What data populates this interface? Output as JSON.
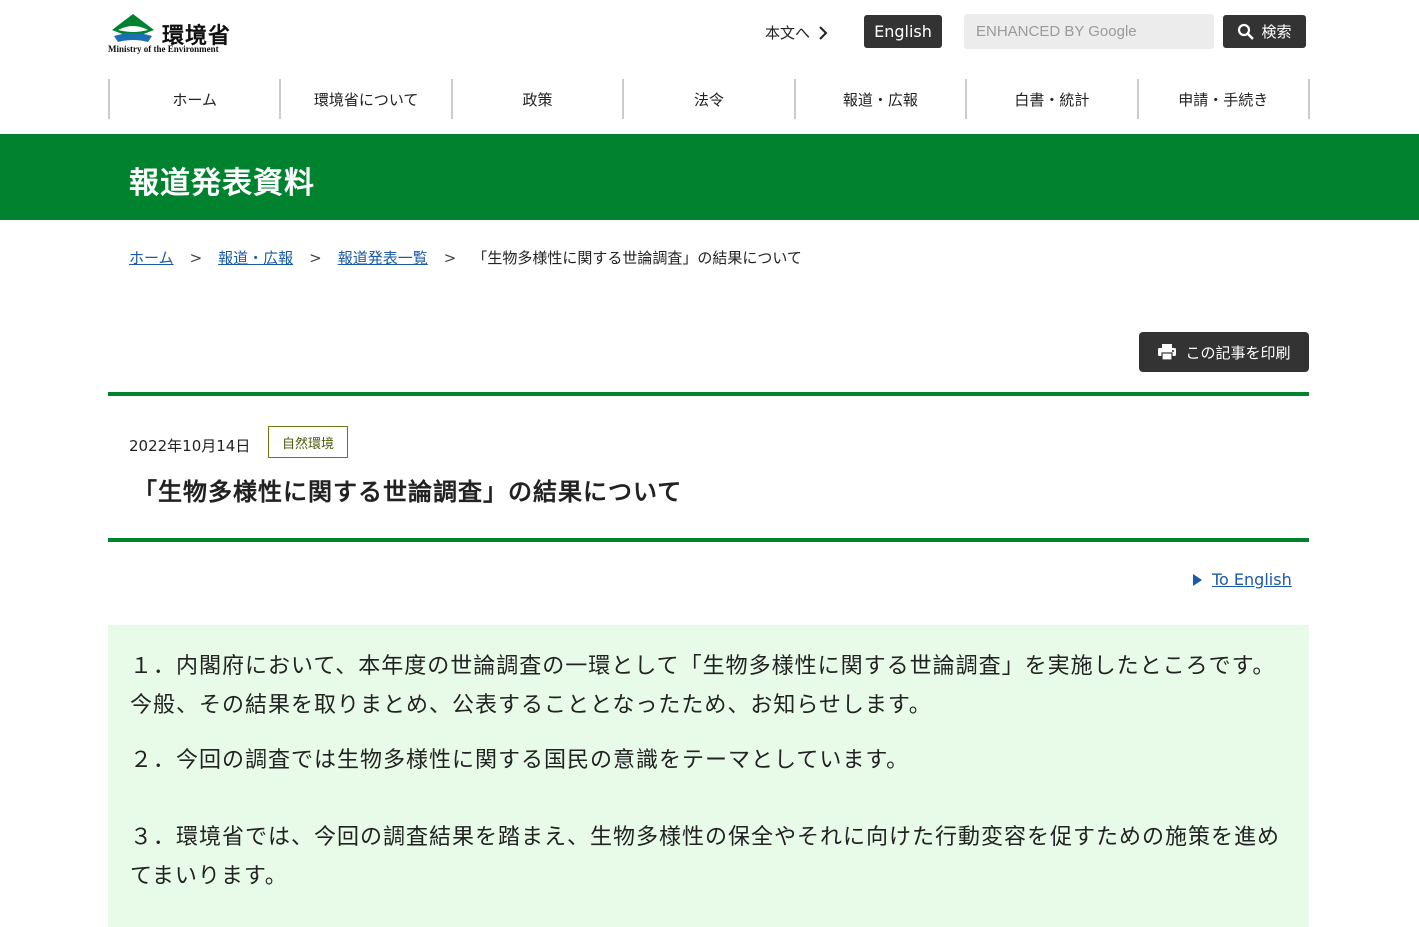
{
  "header": {
    "logo_name": "環境省",
    "logo_sub": "Ministry of the Environment",
    "skip_link": "本文へ",
    "english_label": "English",
    "search_placeholder": "ENHANCED BY Google",
    "search_label": "検索"
  },
  "nav": {
    "items": [
      {
        "label": "ホーム"
      },
      {
        "label": "環境省について"
      },
      {
        "label": "政策"
      },
      {
        "label": "法令"
      },
      {
        "label": "報道・広報"
      },
      {
        "label": "白書・統計"
      },
      {
        "label": "申請・手続き"
      }
    ]
  },
  "banner": {
    "title": "報道発表資料"
  },
  "breadcrumb": {
    "items": [
      {
        "label": "ホーム"
      },
      {
        "label": "報道・広報"
      },
      {
        "label": "報道発表一覧"
      }
    ],
    "separator": ">",
    "current": "「生物多様性に関する世論調査」の結果について"
  },
  "print": {
    "label": "この記事を印刷"
  },
  "article": {
    "date": "2022年10月14日",
    "tag": "自然環境",
    "title": "「生物多様性に関する世論調査」の結果について",
    "to_english": "To English",
    "paragraphs": [
      "１．内閣府において、本年度の世論調査の一環として「生物多様性に関する世論調査」を実施したところです。今般、その結果を取りまとめ、公表することとなったため、お知らせします。",
      "２．今回の調査では生物多様性に関する国民の意識をテーマとしています。",
      "３．環境省では、今回の調査結果を踏まえ、生物多様性の保全やそれに向けた行動変容を促すための施策を進めてまいります。"
    ]
  },
  "colors": {
    "brand_green": "#00822f",
    "link_blue": "#1a5aa6",
    "content_bg": "#e8fbe8",
    "dark_button": "#333333"
  }
}
